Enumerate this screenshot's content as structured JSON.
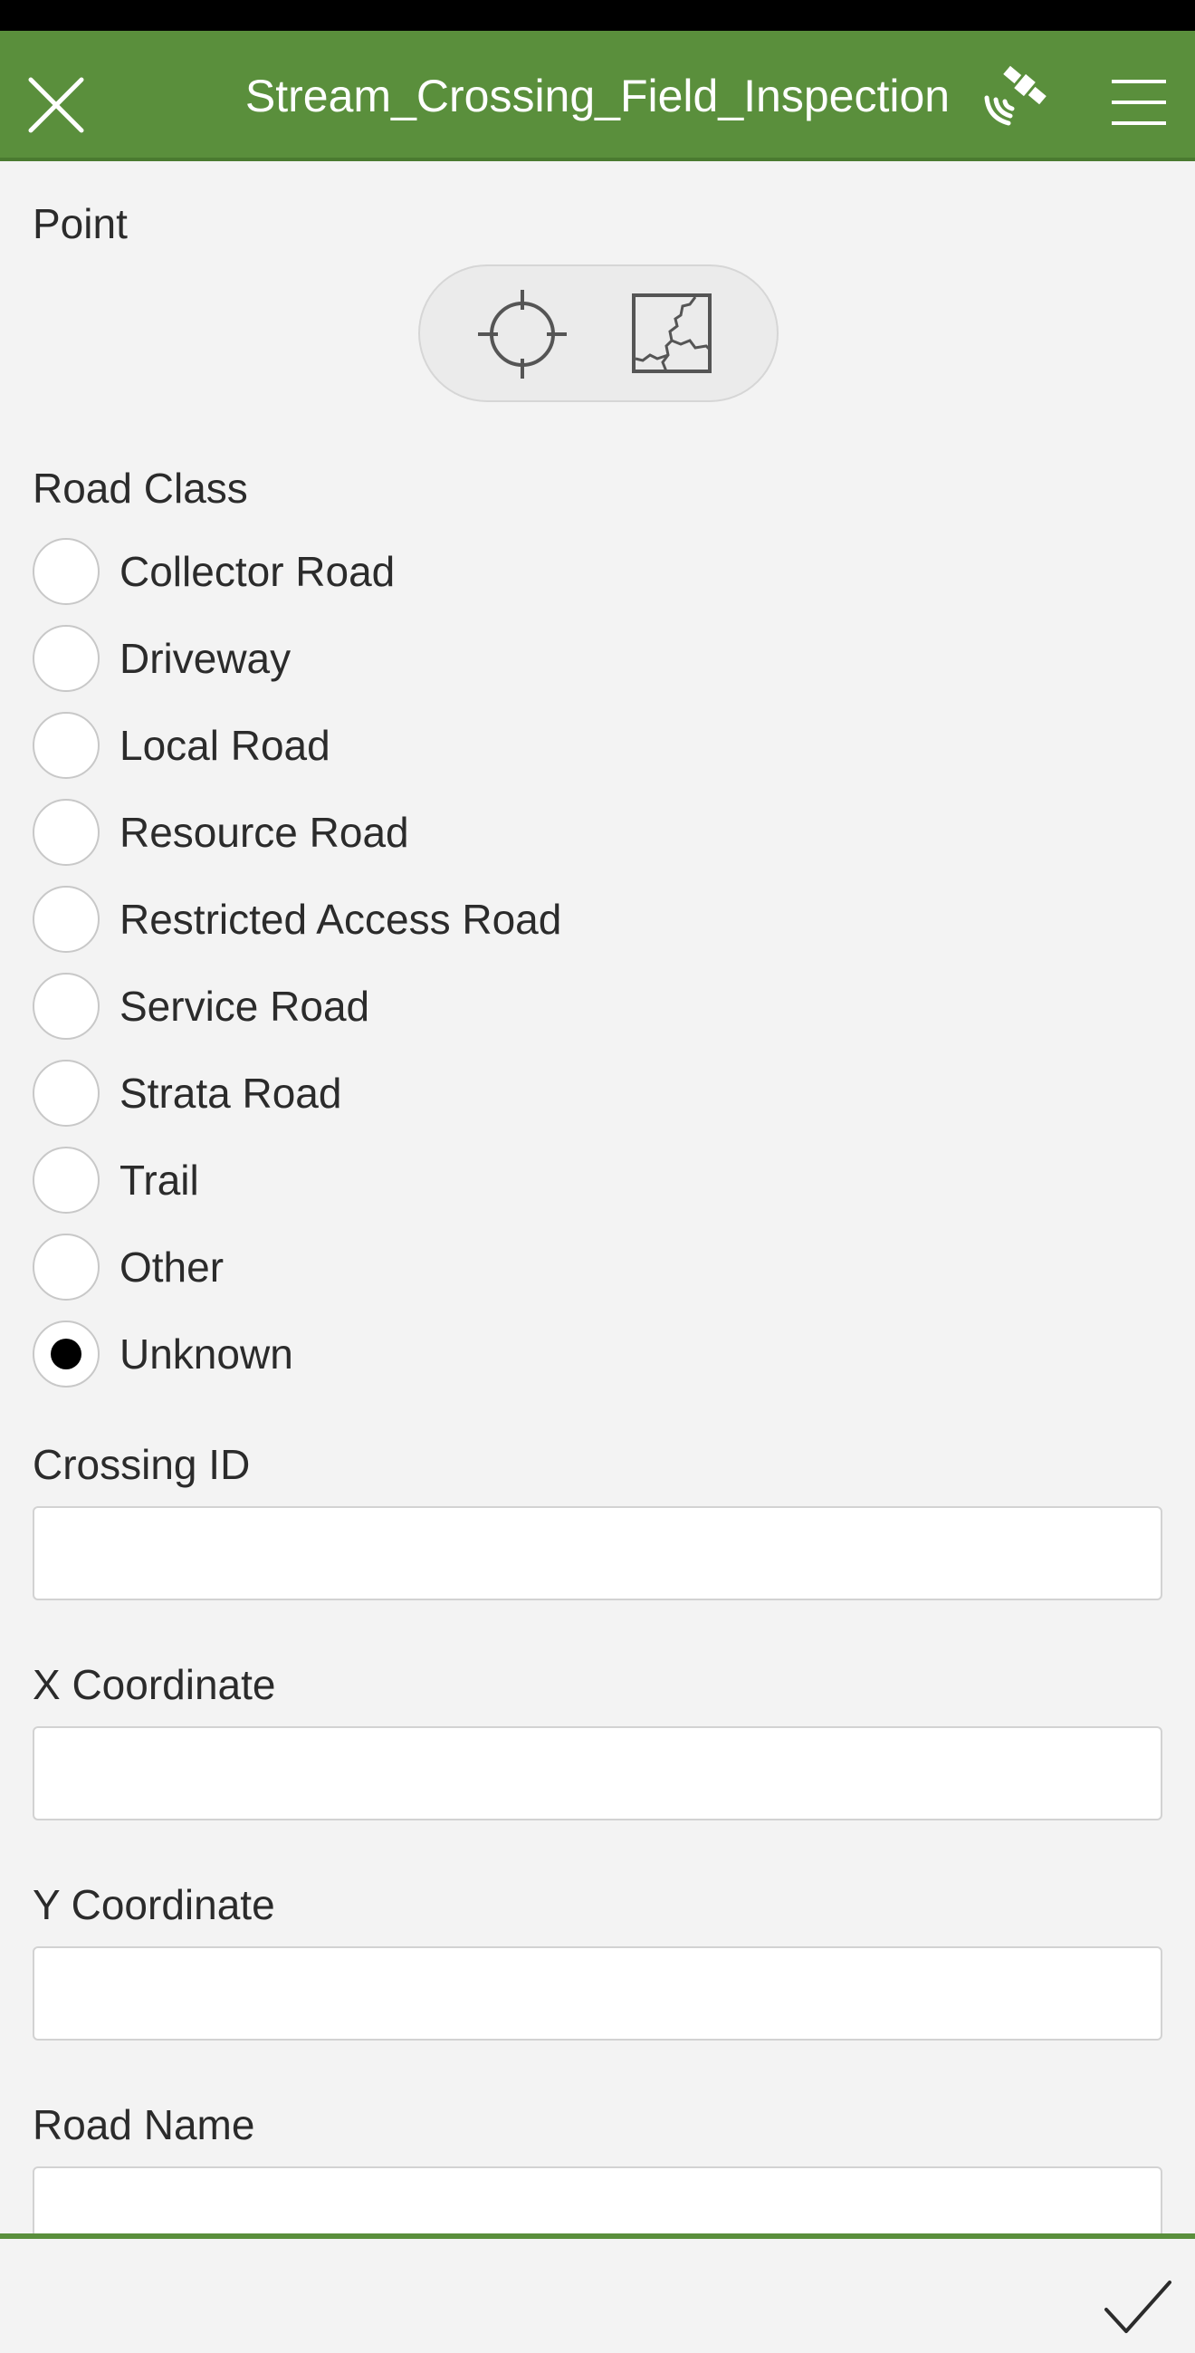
{
  "header": {
    "title": "Stream_Crossing_Field_Inspection",
    "color": "#5a8f3c",
    "icons": {
      "close": "close-icon",
      "gps": "satellite-gps-icon",
      "menu": "hamburger-menu-icon"
    }
  },
  "point": {
    "label": "Point",
    "icons": {
      "gps": "crosshair-icon",
      "map": "map-icon"
    }
  },
  "road_class": {
    "label": "Road Class",
    "selected": "Unknown",
    "options": [
      "Collector Road",
      "Driveway",
      "Local Road",
      "Resource Road",
      "Restricted Access Road",
      "Service Road",
      "Strata Road",
      "Trail",
      "Other",
      "Unknown"
    ]
  },
  "crossing_id": {
    "label": "Crossing ID",
    "value": ""
  },
  "x_coordinate": {
    "label": "X Coordinate",
    "value": ""
  },
  "y_coordinate": {
    "label": "Y Coordinate",
    "value": ""
  },
  "road_name": {
    "label": "Road Name",
    "value": ""
  },
  "footer": {
    "submit_icon": "checkmark-icon"
  }
}
